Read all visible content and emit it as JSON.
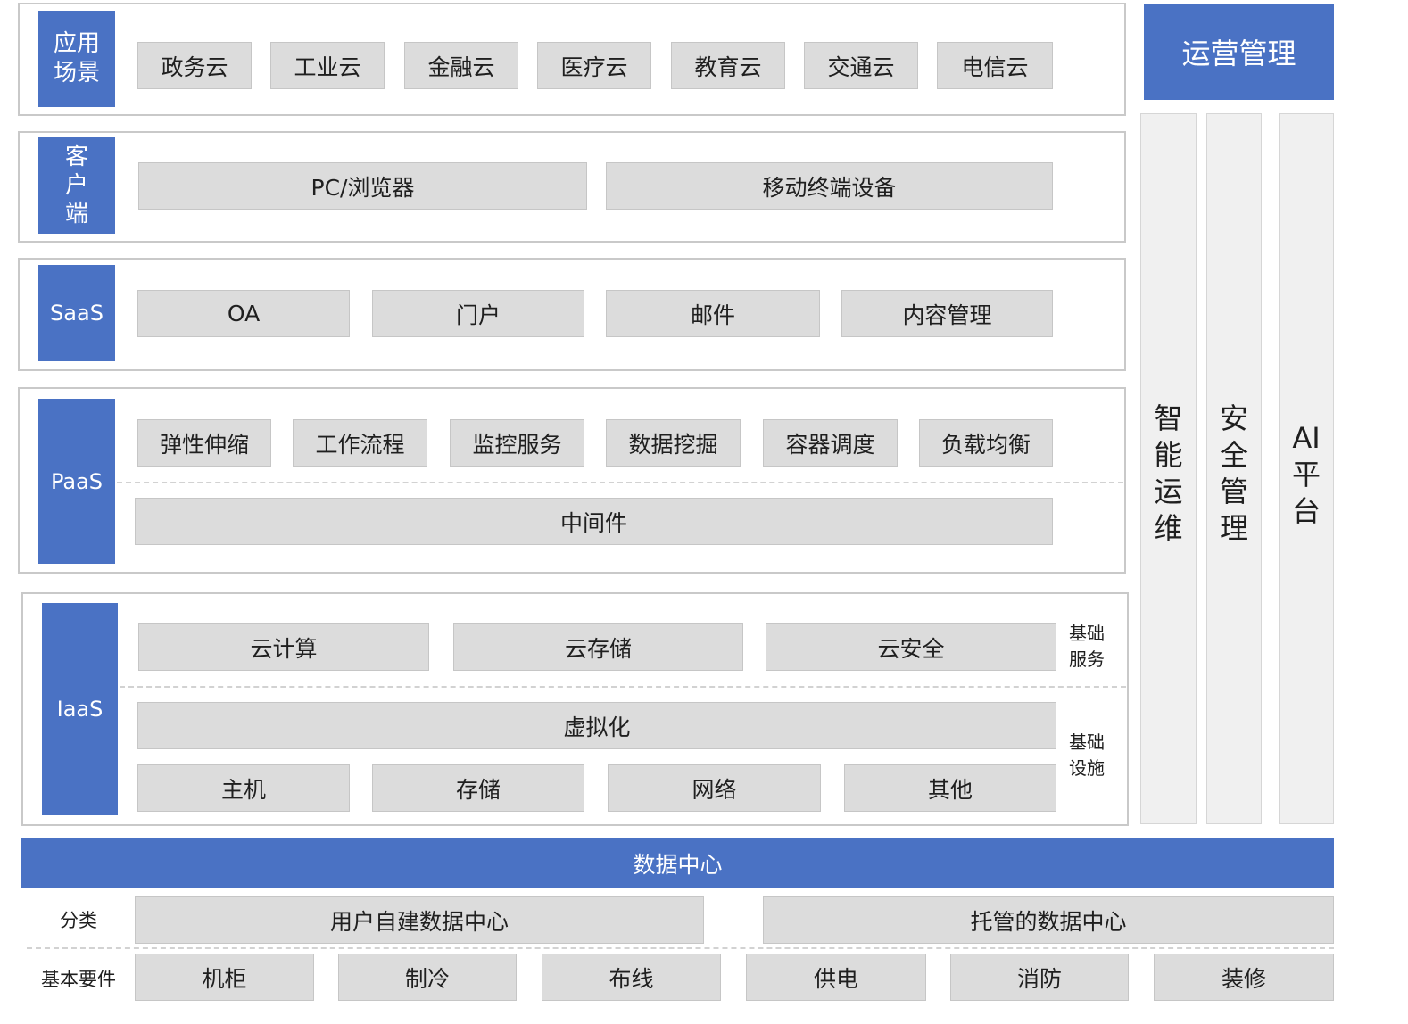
{
  "layers": {
    "scenarios": {
      "label": "应用场景",
      "items": [
        "政务云",
        "工业云",
        "金融云",
        "医疗云",
        "教育云",
        "交通云",
        "电信云"
      ]
    },
    "client": {
      "label": "客户端",
      "items": [
        "PC/浏览器",
        "移动终端设备"
      ]
    },
    "saas": {
      "label": "SaaS",
      "items": [
        "OA",
        "门户",
        "邮件",
        "内容管理"
      ]
    },
    "paas": {
      "label": "PaaS",
      "items": [
        "弹性伸缩",
        "工作流程",
        "监控服务",
        "数据挖掘",
        "容器调度",
        "负载均衡"
      ],
      "middleware": "中间件"
    },
    "iaas": {
      "label": "IaaS",
      "services": [
        "云计算",
        "云存储",
        "云安全"
      ],
      "services_label": "基础服务",
      "virtualization": "虚拟化",
      "infra": [
        "主机",
        "存储",
        "网络",
        "其他"
      ],
      "infra_label": "基础设施"
    }
  },
  "operations": {
    "header": "运营管理",
    "columns": [
      "智能运维",
      "安全管理",
      "AI平台"
    ]
  },
  "datacenter": {
    "header": "数据中心",
    "category_label": "分类",
    "categories": [
      "用户自建数据中心",
      "托管的数据中心"
    ],
    "elements_label": "基本要件",
    "elements": [
      "机柜",
      "制冷",
      "布线",
      "供电",
      "消防",
      "装修"
    ]
  },
  "colors": {
    "accent": "#4a72c4",
    "box": "#dcdcdc",
    "frame": "#c9c9c9"
  }
}
